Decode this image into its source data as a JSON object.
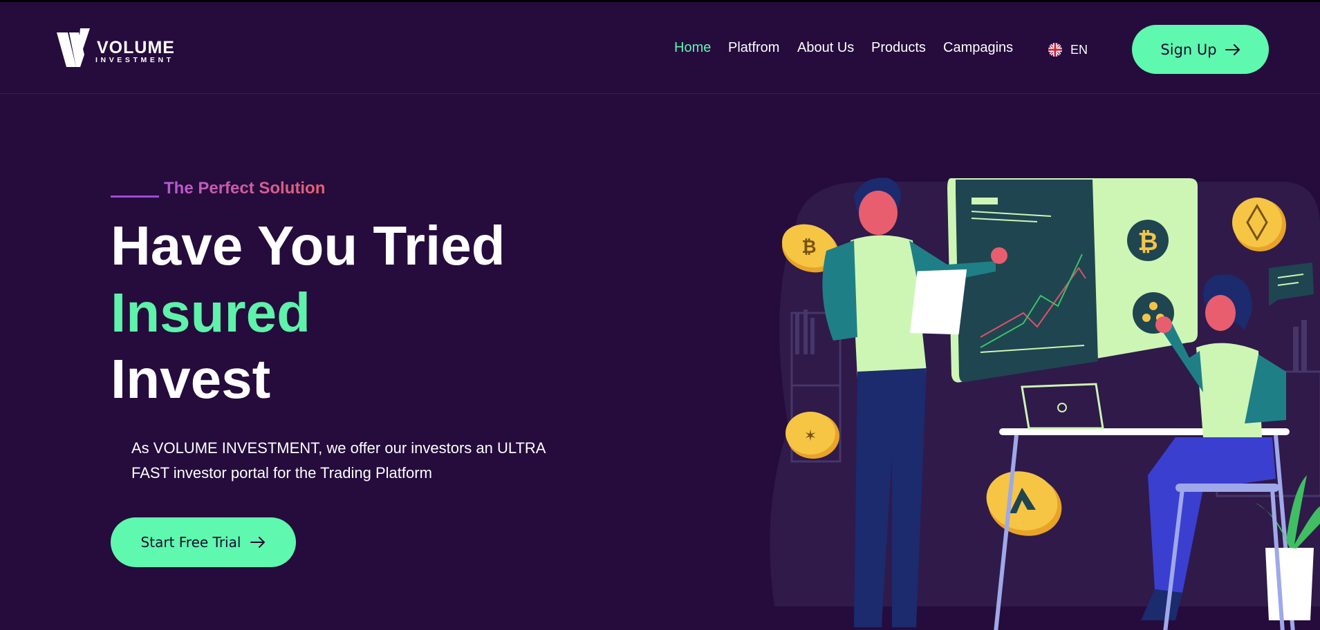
{
  "brand": {
    "name": "VOLUME",
    "subname": "INVESTMENT"
  },
  "nav": {
    "items": [
      {
        "label": "Home",
        "active": true
      },
      {
        "label": "Platfrom",
        "active": false
      },
      {
        "label": "About Us",
        "active": false
      },
      {
        "label": "Products",
        "active": false
      },
      {
        "label": "Campagins",
        "active": false
      }
    ],
    "language": {
      "label": "EN",
      "icon": "uk-flag-icon"
    },
    "signup_label": "Sign Up"
  },
  "hero": {
    "eyebrow": "The Perfect Solution",
    "headline_line1": "Have You Tried",
    "headline_line2": "Insured",
    "headline_line3": "Invest",
    "description": "As VOLUME INVESTMENT, we offer our investors an ULTRA FAST investor portal for the Trading Platform",
    "cta_label": "Start Free Trial"
  },
  "colors": {
    "background": "#250c3c",
    "accent": "#5ef8ae",
    "eyebrow_gradient_start": "#b45bd3",
    "eyebrow_gradient_end": "#ea5f6d"
  }
}
